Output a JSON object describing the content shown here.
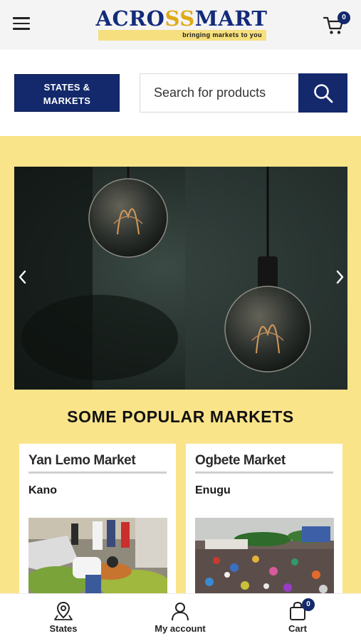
{
  "header": {
    "logo_text_a": "ACRO",
    "logo_text_b": "S",
    "logo_text_c": "MART",
    "logo_tagline": "bringing markets to you",
    "cart_count": "0"
  },
  "search": {
    "states_label_line1": "STATES &",
    "states_label_line2": "MARKETS",
    "placeholder": "Search for products"
  },
  "hero": {
    "image": "hanging-light-bulbs-photo"
  },
  "section": {
    "title": "SOME POPULAR MARKETS"
  },
  "markets": [
    {
      "name": "Yan Lemo Market",
      "state": "Kano",
      "image": "fruit-market-photo"
    },
    {
      "name": "Ogbete Market",
      "state": "Enugu",
      "image": "crowded-market-photo"
    }
  ],
  "bottom_nav": {
    "states_label": "States",
    "account_label": "My account",
    "cart_label": "Cart",
    "cart_count": "0"
  },
  "colors": {
    "brand_navy": "#13296b",
    "brand_yellow": "#fae48a",
    "logo_gold": "#e0a917"
  }
}
